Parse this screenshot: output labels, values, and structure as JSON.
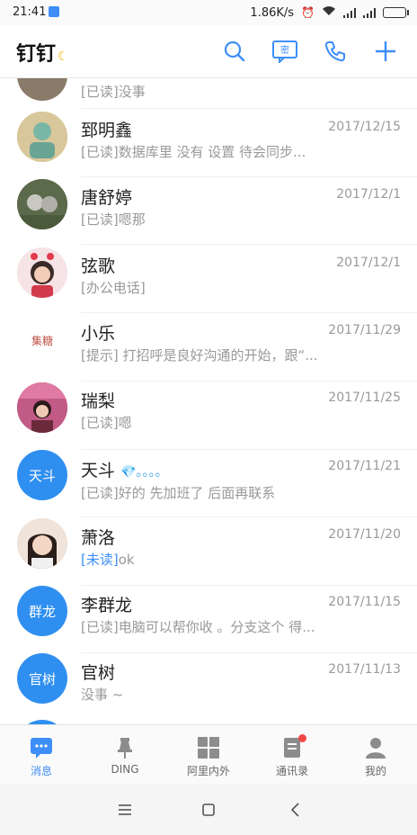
{
  "status": {
    "time": "21:41",
    "speed": "1.86K/s"
  },
  "header": {
    "title": "钉钉"
  },
  "conversations": [
    {
      "name": "",
      "date": "",
      "tag": "[已读]",
      "message": "没事",
      "avatar_text": "",
      "avatar_color": "#8a7a6a"
    },
    {
      "name": "郅明鑫",
      "date": "2017/12/15",
      "tag": "[已读]",
      "message": "数据库里 没有 设置  待会同步...",
      "avatar_text": "",
      "avatar_color": "#c9b98a"
    },
    {
      "name": "唐舒婷",
      "date": "2017/12/1",
      "tag": "[已读]",
      "message": "嗯那",
      "avatar_text": "",
      "avatar_color": "#6c7a5a"
    },
    {
      "name": "弦歌",
      "date": "2017/12/1",
      "tag": "",
      "message": "[办公电话]",
      "avatar_text": "",
      "avatar_color": "#d97a86"
    },
    {
      "name": "小乐",
      "date": "2017/11/29",
      "tag": "[提示]",
      "message": " 打招呼是良好沟通的开始，跟“...",
      "avatar_text": "集糖",
      "avatar_color": "#ffffff"
    },
    {
      "name": "瑞梨",
      "date": "2017/11/25",
      "tag": "[已读]",
      "message": "嗯",
      "avatar_text": "",
      "avatar_color": "#b5567a"
    },
    {
      "name": "天斗",
      "date": "2017/11/21",
      "tag": "[已读]",
      "message": "好的 先加班了 后面再联系",
      "avatar_text": "天斗",
      "avatar_color": "#2f8ff0",
      "name_suffix": "💎。。。。"
    },
    {
      "name": "萧洛",
      "date": "2017/11/20",
      "tag": "[未读]",
      "message": "ok",
      "avatar_text": "",
      "avatar_color": "#e8d6c8",
      "unread": true
    },
    {
      "name": "李群龙",
      "date": "2017/11/15",
      "tag": "[已读]",
      "message": "电脑可以帮你收 。分支这个 得...",
      "avatar_text": "群龙",
      "avatar_color": "#2f8ff0"
    },
    {
      "name": "官树",
      "date": "2017/11/13",
      "tag": "",
      "message": "没事 ~",
      "avatar_text": "官树",
      "avatar_color": "#2f8ff0"
    },
    {
      "name": "",
      "date": "",
      "tag": "",
      "message": "",
      "avatar_text": "",
      "avatar_color": "#2f8ff0"
    }
  ],
  "tabs": [
    {
      "label": "消息",
      "active": true
    },
    {
      "label": "DING",
      "active": false
    },
    {
      "label": "阿里内外",
      "active": false
    },
    {
      "label": "通讯录",
      "active": false,
      "badge": true
    },
    {
      "label": "我的",
      "active": false
    }
  ],
  "accent_color": "#3d8ef7"
}
